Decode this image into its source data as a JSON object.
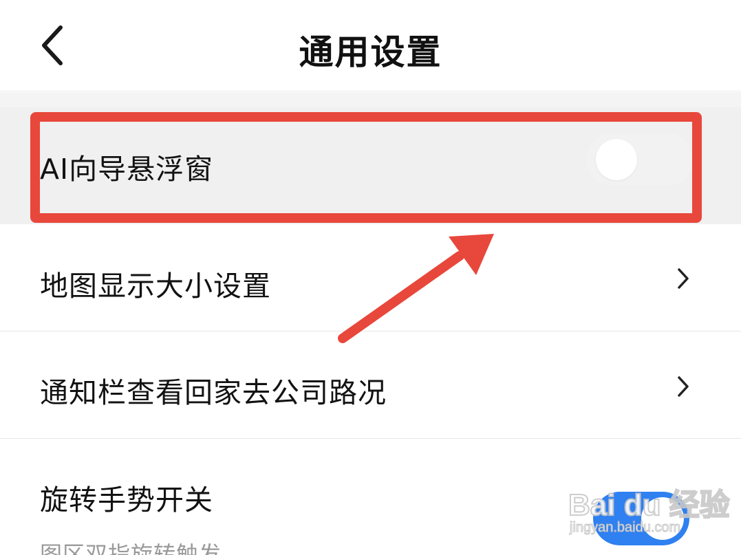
{
  "header": {
    "title": "通用设置",
    "back_icon": "chevron-left-icon"
  },
  "settings": {
    "ai_guide": {
      "label": "AI向导悬浮窗",
      "enabled": false
    },
    "map_size": {
      "label": "地图显示大小设置",
      "icon": "chevron-right-icon"
    },
    "notification": {
      "label": "通知栏查看回家去公司路况",
      "icon": "chevron-right-icon"
    },
    "rotate_gesture": {
      "label": "旋转手势开关",
      "description": "图区双指旋转触发",
      "enabled": true
    }
  },
  "watermark": {
    "logo": "Bai du 经验",
    "url": "jingyan.baidu.com"
  },
  "colors": {
    "accent": "#2f80f0",
    "annotation": "#e8473b",
    "toggle_off": "#f2f2f2"
  }
}
